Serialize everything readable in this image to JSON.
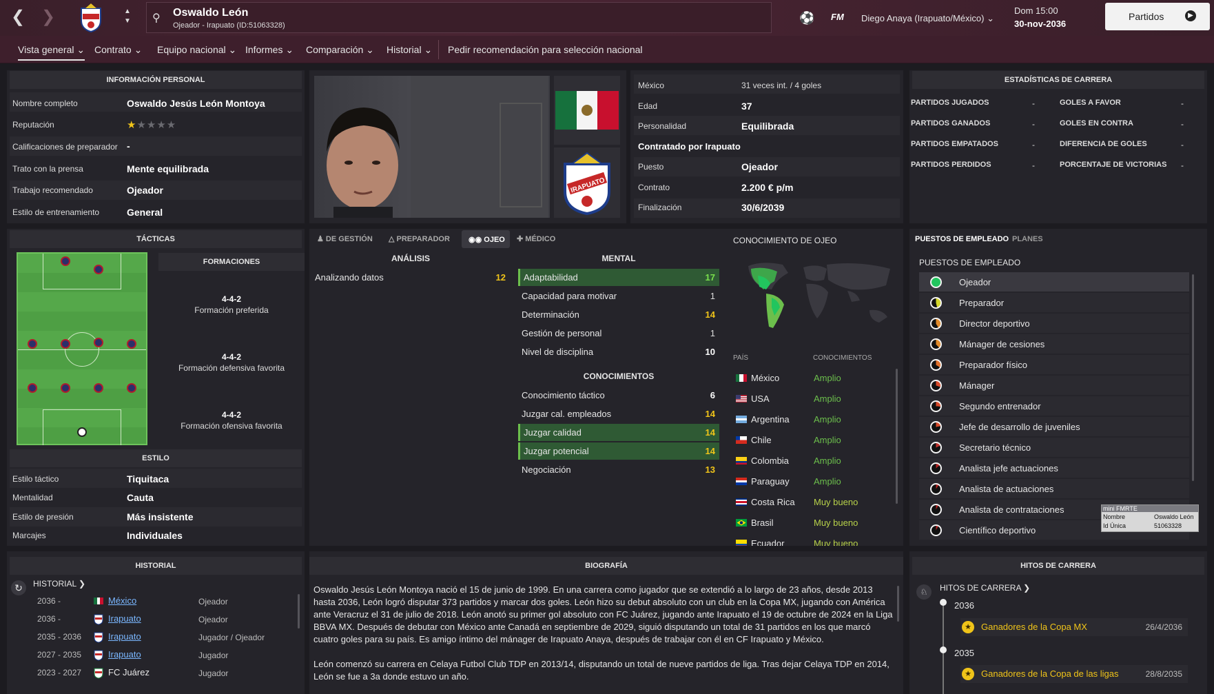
{
  "header": {
    "name": "Oswaldo León",
    "subtitle": "Ojeador - Irapuato (ID:51063328)",
    "fm": "FM",
    "manager": "Diego Anaya (Irapuato/México)",
    "day_time": "Dom 15:00",
    "date": "30-nov-2036",
    "button": "Partidos"
  },
  "nav": {
    "items": [
      "Vista general",
      "Contrato",
      "Equipo nacional",
      "Informes",
      "Comparación",
      "Historial"
    ],
    "extra": "Pedir recomendación para selección nacional"
  },
  "personal": {
    "title": "INFORMACIÓN PERSONAL",
    "rows": [
      {
        "label": "Nombre completo",
        "value": "Oswaldo Jesús León Montoya"
      },
      {
        "label": "Reputación",
        "value": ""
      },
      {
        "label": "Calificaciones de preparador",
        "value": "-"
      },
      {
        "label": "Trato con la prensa",
        "value": "Mente equilibrada"
      },
      {
        "label": "Trabajo recomendado",
        "value": "Ojeador"
      },
      {
        "label": "Estilo de entrenamiento",
        "value": "General"
      }
    ],
    "reputation_stars": 1
  },
  "profile": {
    "rows": [
      {
        "label": "México",
        "value": "31 veces int. / 4 goles"
      },
      {
        "label": "Edad",
        "value": "37"
      },
      {
        "label": "Personalidad",
        "value": "Equilibrada"
      },
      {
        "label": "Contratado por Irapuato",
        "value": ""
      },
      {
        "label": "Puesto",
        "value": "Ojeador"
      },
      {
        "label": "Contrato",
        "value": "2.200 € p/m"
      },
      {
        "label": "Finalización",
        "value": "30/6/2039"
      }
    ],
    "club_crest_text": "IRAPUATO"
  },
  "career_stats": {
    "title": "ESTADÍSTICAS DE CARRERA",
    "left": [
      {
        "label": "PARTIDOS JUGADOS",
        "value": "-"
      },
      {
        "label": "PARTIDOS GANADOS",
        "value": "-"
      },
      {
        "label": "PARTIDOS EMPATADOS",
        "value": "-"
      },
      {
        "label": "PARTIDOS PERDIDOS",
        "value": "-"
      }
    ],
    "right": [
      {
        "label": "GOLES A FAVOR",
        "value": "-"
      },
      {
        "label": "GOLES EN CONTRA",
        "value": "-"
      },
      {
        "label": "DIFERENCIA DE GOLES",
        "value": "-"
      },
      {
        "label": "PORCENTAJE DE VICTORIAS",
        "value": "-"
      }
    ]
  },
  "tactics": {
    "title": "TÁCTICAS",
    "formations_title": "FORMACIONES",
    "formations": [
      {
        "shape": "4-4-2",
        "label": "Formación preferida"
      },
      {
        "shape": "4-4-2",
        "label": "Formación defensiva favorita"
      },
      {
        "shape": "4-4-2",
        "label": "Formación ofensiva favorita"
      }
    ],
    "style_title": "ESTILO",
    "style": [
      {
        "label": "Estilo táctico",
        "value": "Tiquitaca"
      },
      {
        "label": "Mentalidad",
        "value": "Cauta"
      },
      {
        "label": "Estilo de presión",
        "value": "Más insistente"
      },
      {
        "label": "Marcajes",
        "value": "Individuales"
      }
    ]
  },
  "attr_tabs": [
    "DE GESTIÓN",
    "PREPARADOR",
    "OJEO",
    "MÉDICO"
  ],
  "analysis": {
    "title": "ANÁLISIS",
    "rows": [
      {
        "label": "Analizando datos",
        "value": "12"
      }
    ]
  },
  "mental": {
    "title": "MENTAL",
    "rows": [
      {
        "label": "Adaptabilidad",
        "value": "17"
      },
      {
        "label": "Capacidad para motivar",
        "value": "1"
      },
      {
        "label": "Determinación",
        "value": "14"
      },
      {
        "label": "Gestión de personal",
        "value": "1"
      },
      {
        "label": "Nivel de disciplina",
        "value": "10"
      }
    ]
  },
  "knowledge": {
    "title": "CONOCIMIENTOS",
    "rows": [
      {
        "label": "Conocimiento táctico",
        "value": "6"
      },
      {
        "label": "Juzgar cal. empleados",
        "value": "14"
      },
      {
        "label": "Juzgar calidad",
        "value": "14"
      },
      {
        "label": "Juzgar potencial",
        "value": "14"
      },
      {
        "label": "Negociación",
        "value": "13"
      }
    ]
  },
  "scout_knowledge": {
    "title": "CONOCIMIENTO DE OJEO",
    "col_country": "PAÍS",
    "col_level": "CONOCIMIENTOS",
    "rows": [
      {
        "country": "México",
        "level": "Amplio"
      },
      {
        "country": "USA",
        "level": "Amplio"
      },
      {
        "country": "Argentina",
        "level": "Amplio"
      },
      {
        "country": "Chile",
        "level": "Amplio"
      },
      {
        "country": "Colombia",
        "level": "Amplio"
      },
      {
        "country": "Paraguay",
        "level": "Amplio"
      },
      {
        "country": "Costa Rica",
        "level": "Muy bueno"
      },
      {
        "country": "Brasil",
        "level": "Muy bueno"
      },
      {
        "country": "Ecuador",
        "level": "Muy bueno"
      }
    ]
  },
  "jobs": {
    "tab1": "PUESTOS DE EMPLEADO",
    "tab2": "PLANES",
    "title": "PUESTOS DE EMPLEADO",
    "rows": [
      {
        "name": "Ojeador",
        "color": "#22c55e"
      },
      {
        "name": "Preparador",
        "color": "#d4d62a"
      },
      {
        "name": "Director deportivo",
        "color": "#e08a2a"
      },
      {
        "name": "Mánager de cesiones",
        "color": "#e08a2a"
      },
      {
        "name": "Preparador físico",
        "color": "#e0702a"
      },
      {
        "name": "Mánager",
        "color": "#d84a2a"
      },
      {
        "name": "Segundo entrenador",
        "color": "#d84a2a"
      },
      {
        "name": "Jefe de desarrollo de juveniles",
        "color": "#d84a2a"
      },
      {
        "name": "Secretario técnico",
        "color": "#c0302a"
      },
      {
        "name": "Analista jefe actuaciones",
        "color": "#b0201f"
      },
      {
        "name": "Analista de actuaciones",
        "color": "#b0201f"
      },
      {
        "name": "Analista de contrataciones",
        "color": "#b0201f"
      },
      {
        "name": "Científico deportivo",
        "color": "#b0201f"
      }
    ]
  },
  "mini_fmrte": {
    "title": "mini FMRTE",
    "k1": "Nombre",
    "v1": "Oswaldo León",
    "k2": "Id Única",
    "v2": "51063328"
  },
  "history": {
    "title": "HISTORIAL",
    "link": "HISTORIAL",
    "rows": [
      {
        "years": "2036 -",
        "club": "México",
        "role": "Ojeador"
      },
      {
        "years": "2036 -",
        "club": "Irapuato",
        "role": "Ojeador"
      },
      {
        "years": "2035 - 2036",
        "club": "Irapuato",
        "role": "Jugador / Ojeador"
      },
      {
        "years": "2027 - 2035",
        "club": "Irapuato",
        "role": "Jugador"
      },
      {
        "years": "2023 - 2027",
        "club": "FC Juárez",
        "role": "Jugador"
      }
    ]
  },
  "bio": {
    "title": "BIOGRAFÍA",
    "p1": "Oswaldo Jesús León Montoya nació el 15 de junio de 1999. En una carrera como jugador que se extendió a lo largo de 23 años, desde 2013 hasta 2036, León logró disputar 373 partidos y marcar dos goles. León hizo su debut absoluto con un club en la Copa MX, jugando con América ante Veracruz el 31 de julio de 2018. León anotó su primer gol absoluto con FC Juárez, jugando ante Irapuato el 19 de octubre de 2024 en la Liga BBVA MX. Después de debutar con México ante Canadá en septiembre de 2029, siguió disputando un total de 31 partidos en los que marcó cuatro goles para su país. Es amigo íntimo del mánager de Irapuato Anaya, después de trabajar con él en CF Irapuato y México.",
    "p2": "León comenzó su carrera en Celaya Futbol Club TDP en 2013/14, disputando un total de nueve partidos de liga. Tras dejar Celaya TDP en 2014, León se fue a 3a donde estuvo un año."
  },
  "milestones": {
    "title": "HITOS DE CARRERA",
    "link": "HITOS DE CARRERA",
    "groups": [
      {
        "year": "2036",
        "title": "Ganadores de la Copa MX",
        "date": "26/4/2036"
      },
      {
        "year": "2035",
        "title": "Ganadores de la Copa de las ligas",
        "date": "28/8/2035"
      }
    ]
  }
}
